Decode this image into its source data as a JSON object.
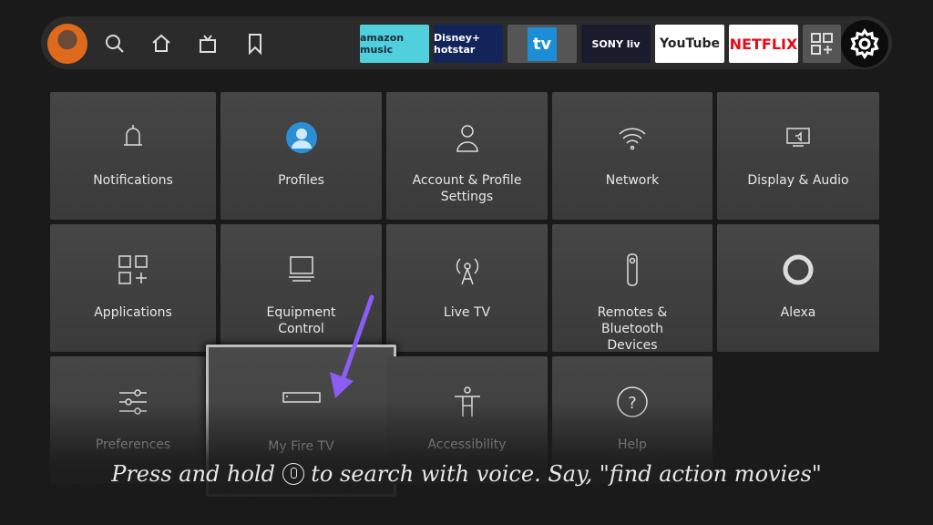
{
  "topbar": {
    "nav_icons": [
      "search-icon",
      "home-icon",
      "live-tv-icon",
      "bookmark-icon"
    ],
    "apps": [
      {
        "name": "amazon music",
        "bg": "#4fd0dc",
        "fg": "#1b2a3a"
      },
      {
        "name": "Disney+ hotstar",
        "bg": "#13245a",
        "fg": "#ffffff"
      },
      {
        "name": "tv",
        "bg": "#555555",
        "fg": "#ffffff"
      },
      {
        "name": "SONY liv",
        "bg": "#1b1b2e",
        "fg": "#ffffff"
      },
      {
        "name": "YouTube",
        "bg": "#ffffff",
        "fg": "#222222"
      },
      {
        "name": "NETFLIX",
        "bg": "#ffffff",
        "fg": "#e50914"
      }
    ]
  },
  "tiles": [
    {
      "label": "Notifications",
      "icon": "bell-icon"
    },
    {
      "label": "Profiles",
      "icon": "profile-icon"
    },
    {
      "label": "Account & Profile Settings",
      "icon": "person-icon"
    },
    {
      "label": "Network",
      "icon": "wifi-icon"
    },
    {
      "label": "Display & Audio",
      "icon": "display-icon"
    },
    {
      "label": "Applications",
      "icon": "apps-icon"
    },
    {
      "label": "Equipment Control",
      "icon": "equipment-icon"
    },
    {
      "label": "Live TV",
      "icon": "antenna-icon"
    },
    {
      "label": "Remotes & Bluetooth Devices",
      "icon": "remote-icon"
    },
    {
      "label": "Alexa",
      "icon": "alexa-icon"
    },
    {
      "label": "Preferences",
      "icon": "sliders-icon"
    },
    {
      "label": "My Fire TV",
      "icon": "fire-tv-icon"
    },
    {
      "label": "Accessibility",
      "icon": "accessibility-icon"
    },
    {
      "label": "Help",
      "icon": "help-icon"
    }
  ],
  "caption": {
    "before": "Press and hold ",
    "after": " to search with voice. Say, \"find action movies\""
  },
  "annotation_color": "#8b5cf6"
}
